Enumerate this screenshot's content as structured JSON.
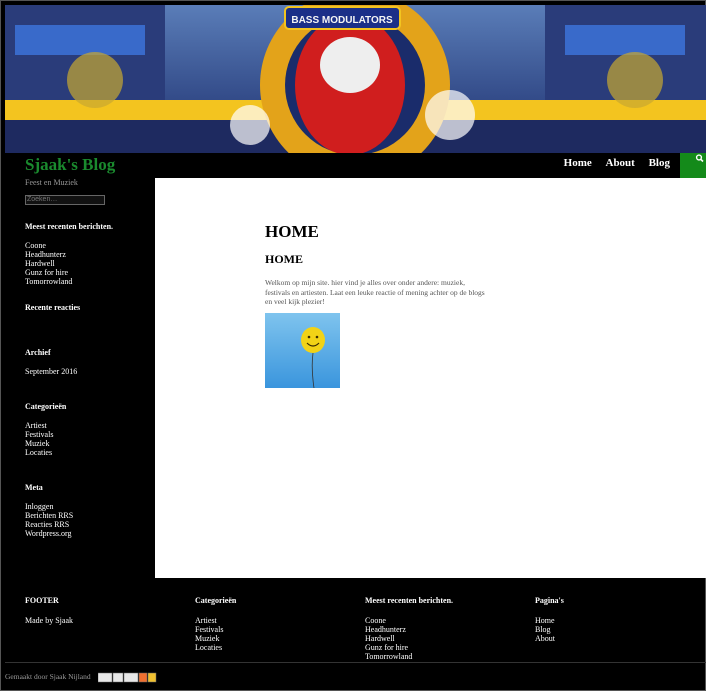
{
  "site": {
    "title": "Sjaak's Blog",
    "tagline": "Feest en Muziek"
  },
  "nav": {
    "items": [
      "Home",
      "About",
      "Blog"
    ]
  },
  "search": {
    "placeholder": "Zoeken…"
  },
  "sidebar": {
    "recent_title": "Meest recenten berichten.",
    "recent": [
      "Coone",
      "Headhunterz",
      "Hardwell",
      "Gunz for hire",
      "Tomorrowland"
    ],
    "comments_title": "Recente reacties",
    "archive_title": "Archief",
    "archive": [
      "September 2016"
    ],
    "categories_title": "Categorieën",
    "categories": [
      "Artiest",
      "Festivals",
      "Muziek",
      "Locaties"
    ],
    "meta_title": "Meta",
    "meta": [
      "Inloggen",
      "Berichten RRS",
      "Reacties RRS",
      "Wordpress.org"
    ]
  },
  "main": {
    "heading": "HOME",
    "subheading": "HOME",
    "body": "Welkom op mijn site. hier vind je alles over onder andere: muziek, festivals en artiesten. Laat een leuke reactie of mening achter op de blogs en veel kijk plezier!"
  },
  "header_image": {
    "sign_text": "BASS MODULATORS"
  },
  "footer": {
    "col1_title": "FOOTER",
    "col1_text": "Made by Sjaak",
    "col2_title": "Categorieën",
    "col2": [
      "Artiest",
      "Festivals",
      "Muziek",
      "Locaties"
    ],
    "col3_title": "Meest recenten berichten.",
    "col3": [
      "Coone",
      "Headhunterz",
      "Hardwell",
      "Gunz for hire",
      "Tomorrowland"
    ],
    "col4_title": "Pagina's",
    "col4": [
      "Home",
      "Blog",
      "About"
    ]
  },
  "credits": {
    "text": "Gemaakt door Sjaak Nijland"
  },
  "colors": {
    "accent": "#148a1a",
    "title": "#1a8a2e"
  }
}
